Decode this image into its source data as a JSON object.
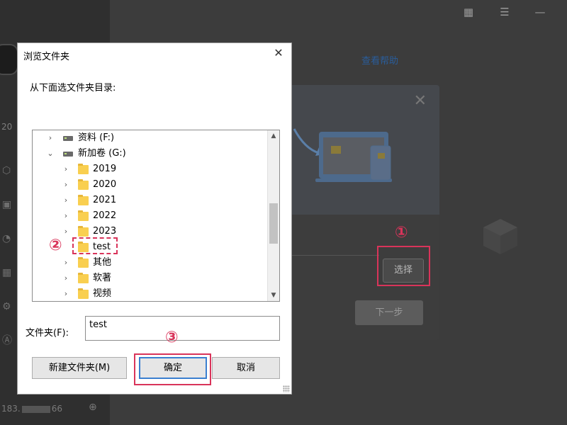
{
  "background_app": {
    "left_label": "20",
    "ip_text": "183.",
    "ip_tail": "66",
    "help_link": "查看帮助",
    "choose_button": "选择",
    "next_button": "下一步"
  },
  "annotations": [
    "①",
    "②",
    "③"
  ],
  "dialog": {
    "title": "浏览文件夹",
    "instruction": "从下面选文件夹目录:",
    "tree": [
      {
        "label": "资料 (F:)",
        "type": "drive",
        "expanded": false
      },
      {
        "label": "新加卷 (G:)",
        "type": "drive",
        "expanded": true
      },
      {
        "label": "2019",
        "type": "folder",
        "expanded": false
      },
      {
        "label": "2020",
        "type": "folder",
        "expanded": false
      },
      {
        "label": "2021",
        "type": "folder",
        "expanded": false
      },
      {
        "label": "2022",
        "type": "folder",
        "expanded": false
      },
      {
        "label": "2023",
        "type": "folder",
        "expanded": false
      },
      {
        "label": "test",
        "type": "folder",
        "expanded": false,
        "selected": true
      },
      {
        "label": "其他",
        "type": "folder",
        "expanded": false
      },
      {
        "label": "软著",
        "type": "folder",
        "expanded": false
      },
      {
        "label": "视频",
        "type": "folder",
        "expanded": false
      }
    ],
    "folder_label": "文件夹(F):",
    "folder_value": "test",
    "buttons": {
      "new_folder": "新建文件夹(M)",
      "ok": "确定",
      "cancel": "取消"
    }
  },
  "colors": {
    "annotation": "#d9345a",
    "ok_focus": "#3b7fd0",
    "folder": "#f9cf50"
  }
}
